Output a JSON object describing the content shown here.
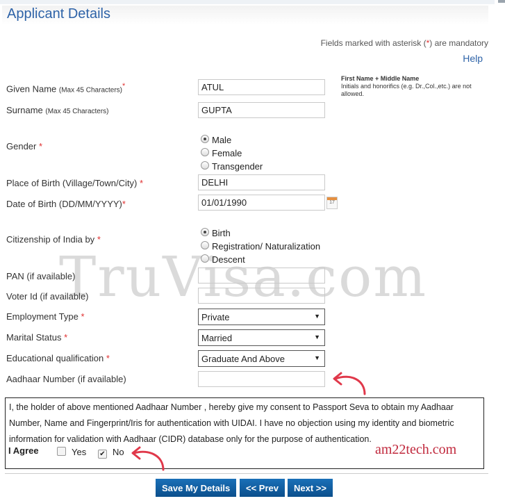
{
  "page": {
    "title": "Applicant Details",
    "mandatory_note_prefix": "Fields marked with asterisk (",
    "mandatory_note_star": "*",
    "mandatory_note_suffix": ") are mandatory",
    "help_link": "Help",
    "watermark": "TruVisa.com",
    "site_watermark": "am22tech.com",
    "required_marker": "*"
  },
  "fields": {
    "given_name": {
      "label": "Given Name",
      "note": "(Max 45 Characters)",
      "value": "ATUL"
    },
    "surname": {
      "label": "Surname",
      "note": "(Max 45 Characters)",
      "value": "GUPTA"
    },
    "name_hint": {
      "title": "First Name + Middle Name",
      "text": "Initials and honorifics (e.g. Dr.,Col.,etc.) are not allowed."
    },
    "gender": {
      "label": "Gender",
      "options": [
        "Male",
        "Female",
        "Transgender"
      ],
      "selected": "Male"
    },
    "place_of_birth": {
      "label": "Place of Birth (Village/Town/City)",
      "value": "DELHI"
    },
    "date_of_birth": {
      "label": "Date of Birth (DD/MM/YYYY)",
      "value": "01/01/1990",
      "calendar_day": "17"
    },
    "citizenship": {
      "label": "Citizenship of India by",
      "options": [
        "Birth",
        "Registration/ Naturalization",
        "Descent"
      ],
      "selected": "Birth"
    },
    "pan": {
      "label": "PAN (if available)",
      "value": ""
    },
    "voter_id": {
      "label": "Voter Id (if available)",
      "value": ""
    },
    "employment_type": {
      "label": "Employment Type",
      "value": "Private"
    },
    "marital_status": {
      "label": "Marital Status",
      "value": "Married"
    },
    "education": {
      "label": "Educational qualification",
      "value": "Graduate And Above"
    },
    "aadhaar": {
      "label": "Aadhaar Number (if available)",
      "value": ""
    }
  },
  "consent": {
    "text": "I, the holder of above mentioned Aadhaar Number , hereby give my consent to Passport Seva to obtain my Aadhaar Number, Name and Fingerprint/Iris for authentication with UIDAI. I have no objection using my identity and biometric information for validation with Aadhaar (CIDR) database only for the purpose of authentication.",
    "agree_label": "I Agree",
    "yes_label": "Yes",
    "no_label": "No",
    "yes_checked": false,
    "no_checked": true
  },
  "buttons": {
    "save": "Save My Details",
    "prev": "<< Prev",
    "next": "Next >>"
  },
  "colors": {
    "title_blue": "#2e63a8",
    "required_red": "#e03030",
    "button_blue": "#0b5fa5",
    "annotation_red": "#e0384a"
  }
}
